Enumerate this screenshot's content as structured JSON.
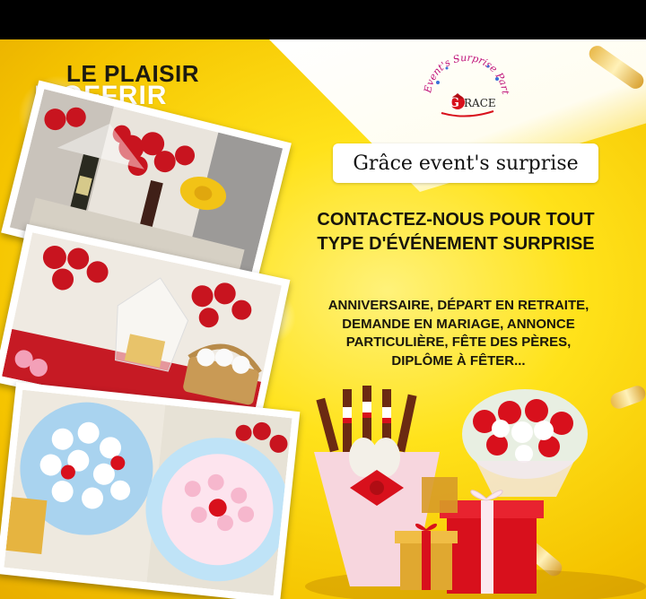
{
  "headline": {
    "line1": "LE PLAISIR",
    "line2": "D'OFFRIR"
  },
  "logo": {
    "arc_text": "Event's Surprise Party",
    "name": "GRACE"
  },
  "brand": {
    "name": "Grâce event's surprise"
  },
  "contact": {
    "line1": "CONTACTEZ-NOUS POUR TOUT",
    "line2": "TYPE D'ÉVÉNEMENT SURPRISE"
  },
  "events": {
    "line1": "ANNIVERSAIRE, DÉPART EN RETRAITE,",
    "line2": "DEMANDE EN MARIAGE, ANNONCE",
    "line3": "PARTICULIÈRE, FÊTE DES PÈRES,",
    "line4": "DIPLÔME À FÊTER..."
  },
  "colors": {
    "background": "#ffe21a",
    "text_dark": "#17140c",
    "accent_red": "#d8101c",
    "gold": "#e3b23c"
  }
}
